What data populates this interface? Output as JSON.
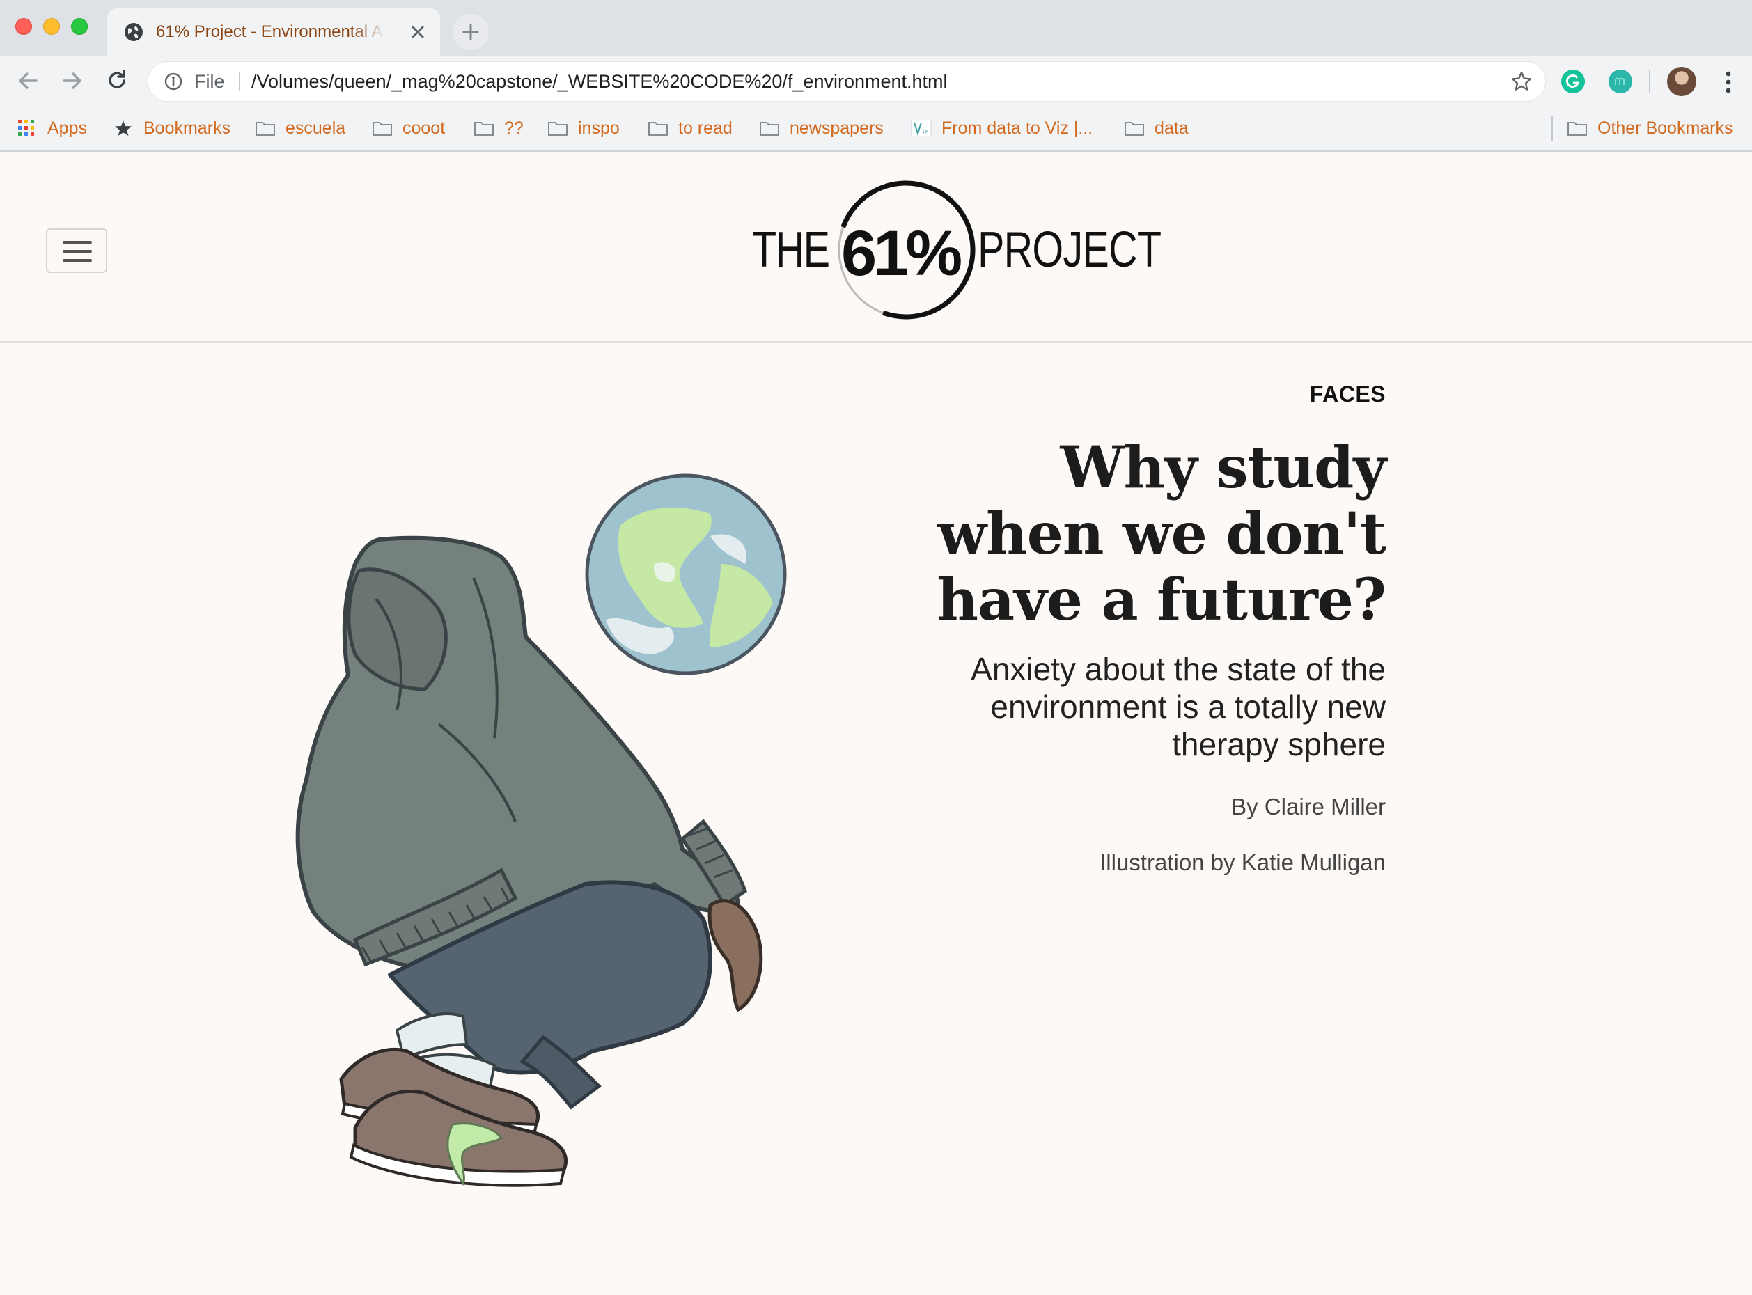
{
  "browser": {
    "tab": {
      "title": "61% Project - Environmental Anxiety"
    },
    "address": {
      "scheme_label": "File",
      "url": "/Volumes/queen/_mag%20capstone/_WEBSITE%20CODE%20/f_environment.html"
    },
    "bookmarks": [
      {
        "label": "Apps",
        "icon": "apps-grid-icon"
      },
      {
        "label": "Bookmarks",
        "icon": "star-icon"
      },
      {
        "label": "escuela",
        "icon": "folder-icon"
      },
      {
        "label": "cooot",
        "icon": "folder-icon"
      },
      {
        "label": "??",
        "icon": "folder-icon"
      },
      {
        "label": "inspo",
        "icon": "folder-icon"
      },
      {
        "label": "to read",
        "icon": "folder-icon"
      },
      {
        "label": "newspapers",
        "icon": "folder-icon"
      },
      {
        "label": "From data to Viz |...",
        "icon": "viz-favicon-icon"
      },
      {
        "label": "data",
        "icon": "folder-icon"
      },
      {
        "label": "Other Bookmarks",
        "icon": "folder-icon"
      }
    ],
    "bookmark_label_color": "#d2691e"
  },
  "site": {
    "logo": {
      "the": "THE",
      "number": "61%",
      "project": "PROJECT"
    }
  },
  "article": {
    "section": "FACES",
    "headline": "Why study when we don't have a future?",
    "dek": "Anxiety about the state of the environment is a totally new therapy sphere",
    "byline": "By Claire Miller",
    "illustration_credit": "Illustration by Katie Mulligan"
  },
  "colors": {
    "page_bg": "#fdf9f6",
    "hoodie": "#75817d",
    "pants": "#566370",
    "shoes": "#8b766d",
    "earth_land": "#c5e8a4",
    "earth_ocean": "#9fc2cf",
    "laces": "#c2eaa8"
  }
}
